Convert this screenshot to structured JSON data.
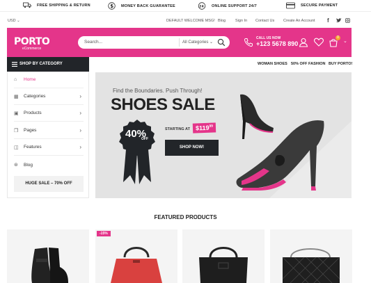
{
  "topbar": {
    "items": [
      {
        "label": "FREE SHIPPING & RETURN",
        "icon": "truck-icon"
      },
      {
        "label": "MONEY BACK GUARANTEE",
        "icon": "dollar-icon"
      },
      {
        "label": "ONLINE SUPPORT 24/7",
        "icon": "support-24-icon"
      },
      {
        "label": "SECURE PAYMENT",
        "icon": "card-icon"
      }
    ]
  },
  "util": {
    "currency": "USD",
    "welcome": "DEFAULT WELCOME MSG!",
    "links": [
      "Blog",
      "Sign In",
      "Contact Us",
      "Create An Account"
    ],
    "social": [
      "f",
      "t",
      "ig"
    ]
  },
  "header": {
    "logo": "PORTO",
    "logo_sub": "eCommerce",
    "search_placeholder": "Search...",
    "search_category": "All Categories",
    "call_label": "CALL US NOW",
    "call_number": "+123 5678 890",
    "cart_count": "0",
    "brand_color": "#e4358a"
  },
  "category_bar": {
    "label": "SHOP BY CATEGORY"
  },
  "nav": [
    "WOMAN SHOES",
    "50% OFF FASHION",
    "BUY PORTO!"
  ],
  "sidebar": {
    "items": [
      {
        "label": "Home",
        "icon": "home-icon",
        "active": true
      },
      {
        "label": "Categories",
        "icon": "grid-icon"
      },
      {
        "label": "Products",
        "icon": "box-icon"
      },
      {
        "label": "Pages",
        "icon": "pages-icon"
      },
      {
        "label": "Features",
        "icon": "features-icon"
      },
      {
        "label": "Blog",
        "icon": "blog-icon"
      }
    ],
    "sale": "HUGE SALE – 70% OFF"
  },
  "banner": {
    "tagline": "Find the Boundaries. Push Through!",
    "title": "SHOES SALE",
    "badge_percent": "40%",
    "badge_off": "OFF",
    "starting_at": "STARTING AT",
    "price": "$119",
    "price_cents": "99",
    "cta": "SHOP NOW!"
  },
  "featured": {
    "title": "FEATURED PRODUCTS",
    "products": [
      {
        "kind": "boots"
      },
      {
        "kind": "red-handbag",
        "discount": "-15%"
      },
      {
        "kind": "black-bag"
      },
      {
        "kind": "quilted-bag"
      }
    ]
  }
}
